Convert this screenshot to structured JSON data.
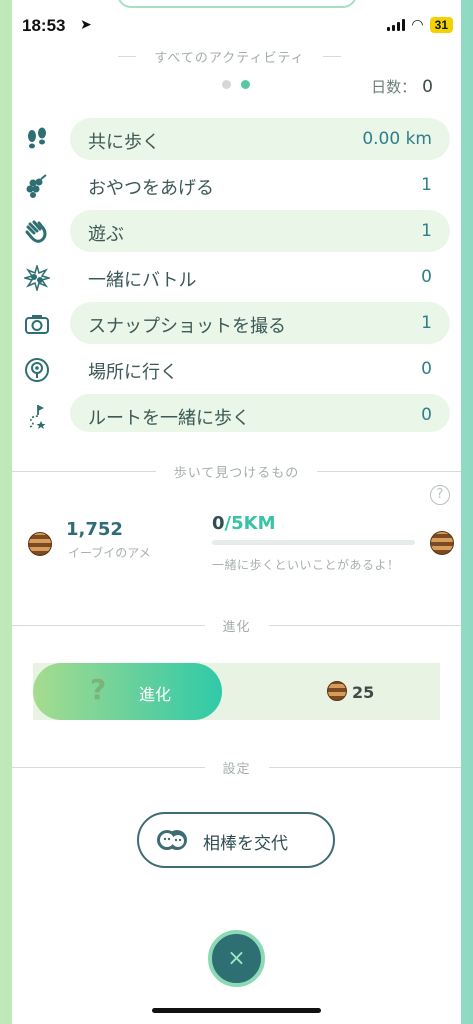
{
  "status_bar": {
    "time": "18:53",
    "battery": "31"
  },
  "activities": {
    "section_title": "すべてのアクティビティ",
    "days_label": "日数：",
    "days_value": "0",
    "rows": [
      {
        "label": "共に歩く",
        "value": "0.00 km"
      },
      {
        "label": "おやつをあげる",
        "value": "1"
      },
      {
        "label": "遊ぶ",
        "value": "1"
      },
      {
        "label": "一緒にバトル",
        "value": "0"
      },
      {
        "label": "スナップショットを撮る",
        "value": "1"
      },
      {
        "label": "場所に行く",
        "value": "0"
      },
      {
        "label": "ルートを一緒に歩く",
        "value": "0"
      }
    ],
    "page_dots": {
      "count": 2,
      "active_index": 1
    }
  },
  "walk": {
    "section_title": "歩いて見つけるもの",
    "help": "?",
    "candy_count": "1,752",
    "candy_name": "イーブイのアメ",
    "distance_current": "0",
    "distance_goal": "/5KM",
    "distance_progress": 0,
    "hint": "一緒に歩くといいことがあるよ！"
  },
  "evolve": {
    "section_title": "進化",
    "question_mark": "?",
    "button_label": "進化",
    "candy_cost": "25"
  },
  "settings": {
    "section_title": "設定",
    "swap_button_label": "相棒を交代"
  },
  "close_label": "×",
  "colors": {
    "accent_teal": "#37c4a6",
    "pill_bg": "#eaf6e7",
    "text_value": "#2f7f8a",
    "dark_teal": "#2d6f72"
  }
}
